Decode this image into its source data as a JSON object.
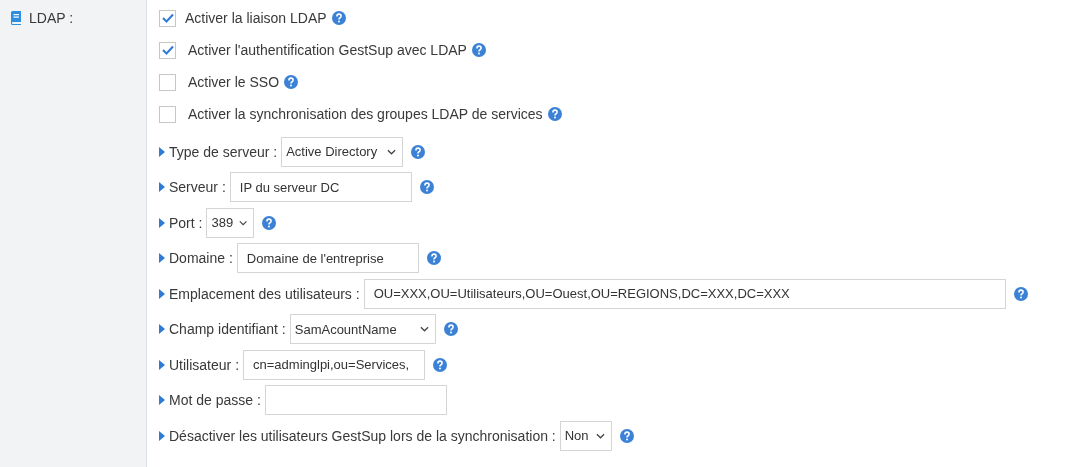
{
  "section": {
    "label": "LDAP :"
  },
  "checkboxes": [
    {
      "label": "Activer la liaison LDAP",
      "checked": true
    },
    {
      "label": "Activer l'authentification GestSup avec LDAP",
      "checked": true
    },
    {
      "label": "Activer le SSO",
      "checked": false
    },
    {
      "label": "Activer la synchronisation des groupes LDAP de services",
      "checked": false
    }
  ],
  "fields": [
    {
      "label": "Type de serveur :",
      "kind": "select",
      "value": "Active Directory",
      "help": true
    },
    {
      "label": "Serveur :",
      "kind": "input",
      "value": "IP du serveur DC",
      "help": true
    },
    {
      "label": "Port :",
      "kind": "select",
      "value": "389",
      "help": true
    },
    {
      "label": "Domaine :",
      "kind": "input",
      "value": "Domaine de l'entreprise",
      "help": true
    },
    {
      "label": "Emplacement des utilisateurs :",
      "kind": "input",
      "value": "OU=XXX,OU=Utilisateurs,OU=Ouest,OU=REGIONS,DC=XXX,DC=XXX",
      "help": true
    },
    {
      "label": "Champ identifiant :",
      "kind": "select",
      "value": "SamAcountName",
      "help": true
    },
    {
      "label": "Utilisateur :",
      "kind": "input",
      "value": "cn=adminglpi,ou=Services,",
      "help": true
    },
    {
      "label": "Mot de passe :",
      "kind": "input",
      "help": false
    },
    {
      "label": "Désactiver les utilisateurs GestSup lors de la synchronisation :",
      "kind": "select",
      "value": "Non",
      "help": true
    }
  ]
}
